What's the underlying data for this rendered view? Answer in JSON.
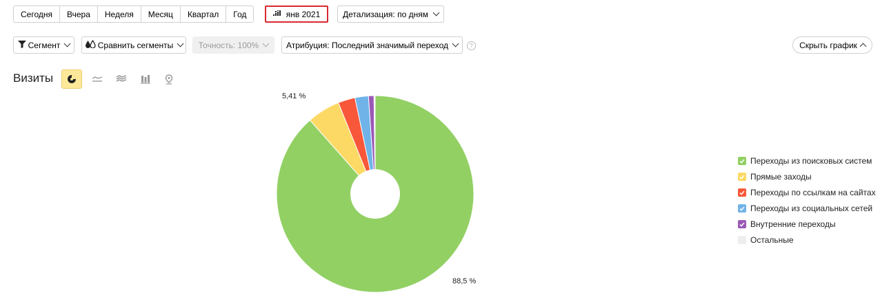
{
  "toolbar": {
    "periods": [
      "Сегодня",
      "Вчера",
      "Неделя",
      "Месяц",
      "Квартал",
      "Год"
    ],
    "date_label": "янв 2021",
    "detail_label": "Детализация: по дням"
  },
  "filters": {
    "segment_label": "Сегмент",
    "compare_label": "Сравнить сегменты",
    "precision_label": "Точность: 100%",
    "attribution_label": "Атрибуция: Последний значимый переход",
    "help_mark": "?",
    "hide_chart_label": "Скрыть график"
  },
  "report": {
    "title": "Визиты",
    "view_icons": [
      "pie-view-icon",
      "line-view-icon",
      "area-view-icon",
      "bar-view-icon",
      "map-view-icon"
    ]
  },
  "chart_data": {
    "type": "pie",
    "labels": [
      "Переходы из поисковых систем",
      "Прямые заходы",
      "Переходы по ссылкам на сайтах",
      "Переходы из социальных сетей",
      "Внутренние переходы",
      "Остальные"
    ],
    "values": [
      88.5,
      5.41,
      2.8,
      2.2,
      0.9,
      0.19
    ],
    "colors": [
      "#92d064",
      "#fcd964",
      "#f9573a",
      "#6fb3e8",
      "#9b59b6",
      "#eeeeee"
    ],
    "data_labels": [
      "88,5 %",
      "5,41 %"
    ],
    "legend_position": "right",
    "donut": true
  }
}
